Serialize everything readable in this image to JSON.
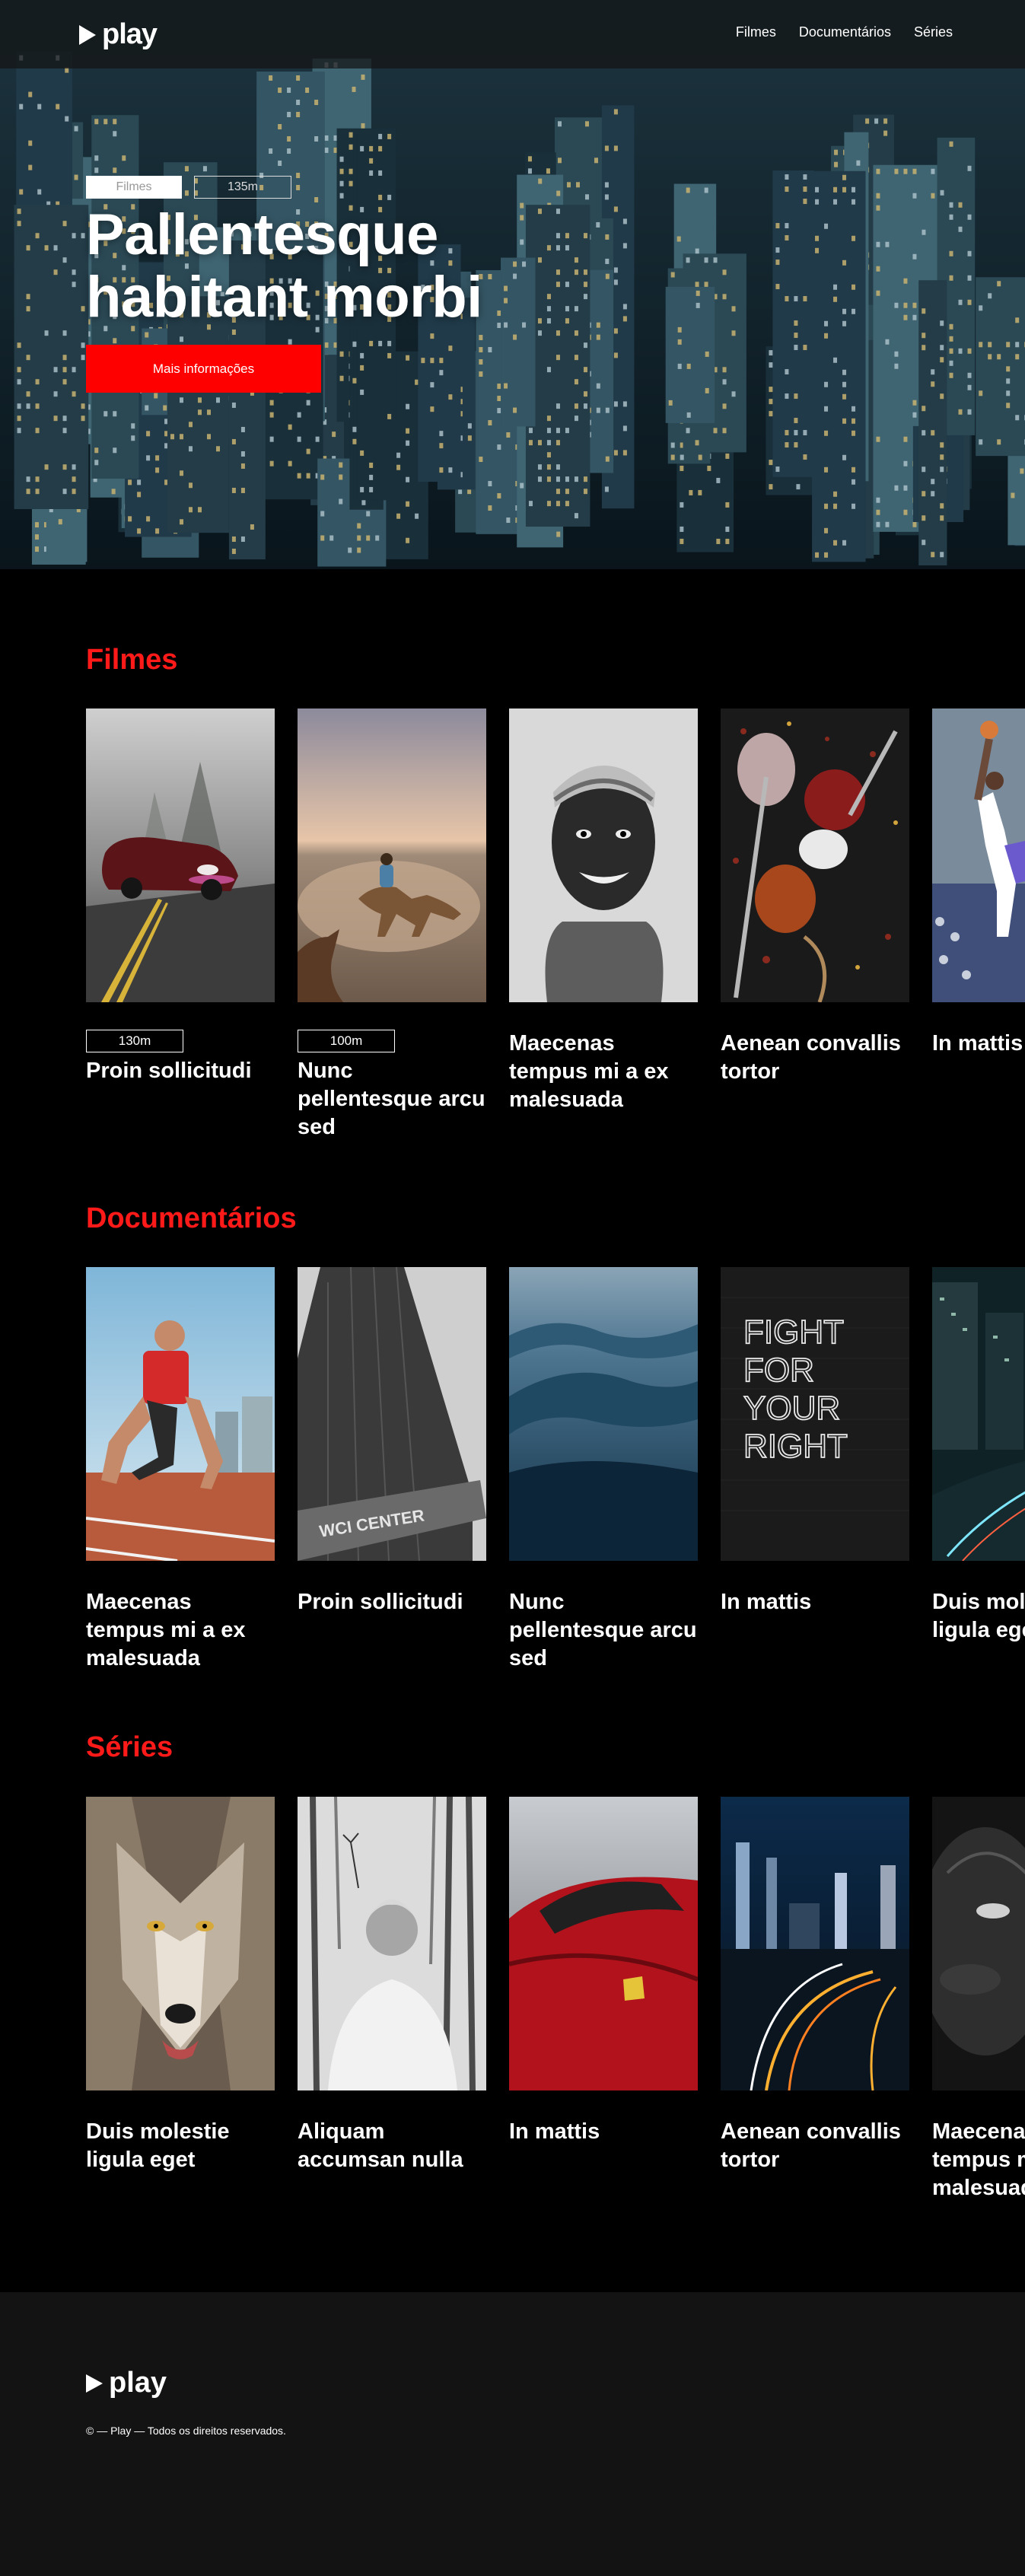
{
  "header": {
    "logo_text": "play",
    "nav": [
      "Filmes",
      "Documentários",
      "Séries"
    ]
  },
  "hero": {
    "tag_category": "Filmes",
    "tag_duration": "135m",
    "title_line1": "Pallentesque",
    "title_line2": "habitant morbi",
    "button_label": "Mais informações"
  },
  "sections": [
    {
      "title": "Filmes",
      "cards": [
        {
          "duration": "130m",
          "title": "Proin sollicitudi",
          "image": "car-in-fog"
        },
        {
          "duration": "100m",
          "title": "Nunc pellentesque arcu sed",
          "image": "horse-rider"
        },
        {
          "title": "Maecenas tempus mi a ex malesuada",
          "image": "child-portrait"
        },
        {
          "title": "Aenean convallis tortor",
          "image": "spices"
        },
        {
          "title": "In mattis",
          "image": "basketball"
        }
      ]
    },
    {
      "title": "Documentários",
      "cards": [
        {
          "title": "Maecenas tempus mi a ex malesuada",
          "image": "sprinter"
        },
        {
          "title": "Proin sollicitudi",
          "image": "wci-center-building"
        },
        {
          "title": "Nunc pellentesque arcu sed",
          "image": "ocean-wave"
        },
        {
          "title": "In mattis",
          "image": "fight-for-your-right-neon"
        },
        {
          "title": "Duis molestie ligula eget",
          "image": "city-night-traffic"
        }
      ]
    },
    {
      "title": "Séries",
      "cards": [
        {
          "title": "Duis molestie ligula eget",
          "image": "wolf"
        },
        {
          "title": "Aliquam accumsan nulla",
          "image": "woman-in-woods"
        },
        {
          "title": "In mattis",
          "image": "red-sports-car"
        },
        {
          "title": "Aenean convallis tortor",
          "image": "city-light-trails"
        },
        {
          "title": "Maecenas tempus mi a ex malesuada",
          "image": "dark-portrait"
        }
      ]
    }
  ],
  "neon_text": [
    "FIGHT",
    "FOR",
    "YOUR",
    "RIGHT"
  ],
  "building_sign": "WCI CENTER",
  "footer": {
    "logo_text": "play",
    "copyright": "© — Play — Todos os direitos reservados."
  },
  "colors": {
    "accent": "#ff0000",
    "section_title": "#ff1a1a",
    "background": "#000000",
    "footer_bg": "#131313"
  }
}
